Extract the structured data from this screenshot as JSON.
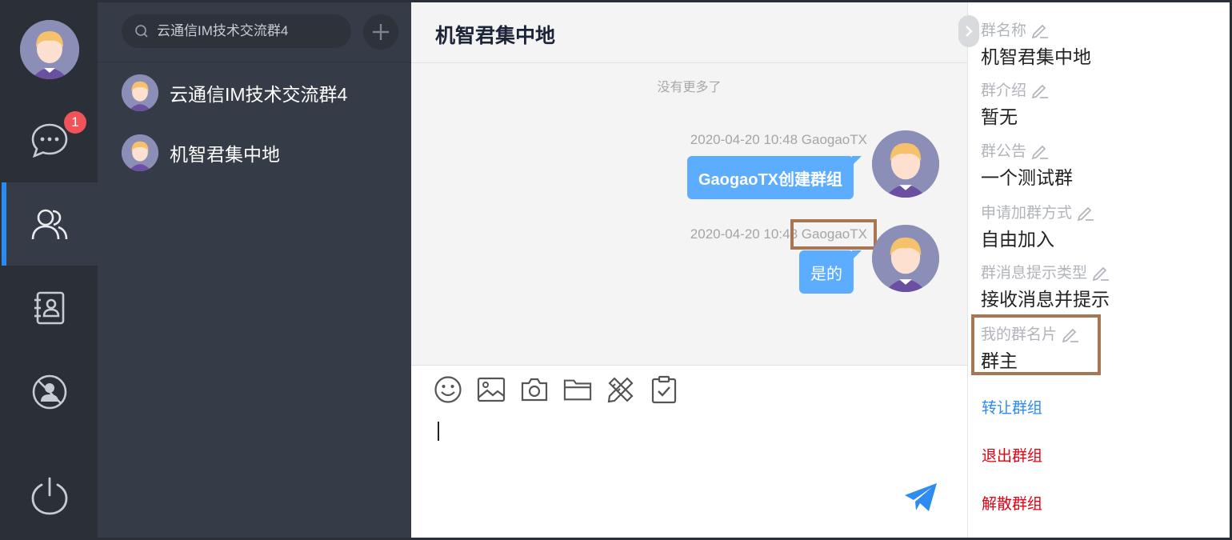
{
  "search": {
    "placeholder": "云通信IM技术交流群4"
  },
  "nav": {
    "unread_badge": "1"
  },
  "conversations": [
    {
      "name": "云通信IM技术交流群4"
    },
    {
      "name": "机智君集中地"
    }
  ],
  "chat": {
    "title": "机智君集中地",
    "no_more": "没有更多了",
    "messages": [
      {
        "time": "2020-04-20 10:48",
        "sender": "GaogaoTX",
        "text": "GaogaoTX创建群组"
      },
      {
        "time": "2020-04-20 10:48",
        "sender": "GaogaoTX",
        "text": "是的"
      }
    ]
  },
  "group_info": {
    "name_label": "群名称",
    "name_value": "机智君集中地",
    "intro_label": "群介绍",
    "intro_value": "暂无",
    "notice_label": "群公告",
    "notice_value": "一个测试群",
    "join_label": "申请加群方式",
    "join_value": "自由加入",
    "msg_type_label": "群消息提示类型",
    "msg_type_value": "接收消息并提示",
    "card_label": "我的群名片",
    "card_value": "群主",
    "transfer": "转让群组",
    "quit": "退出群组",
    "dismiss": "解散群组"
  },
  "colors": {
    "accent": "#2d8cf0",
    "bubble": "#5cadff",
    "danger": "#e60012",
    "link": "#2d8cf0",
    "badge": "#f0535a"
  }
}
